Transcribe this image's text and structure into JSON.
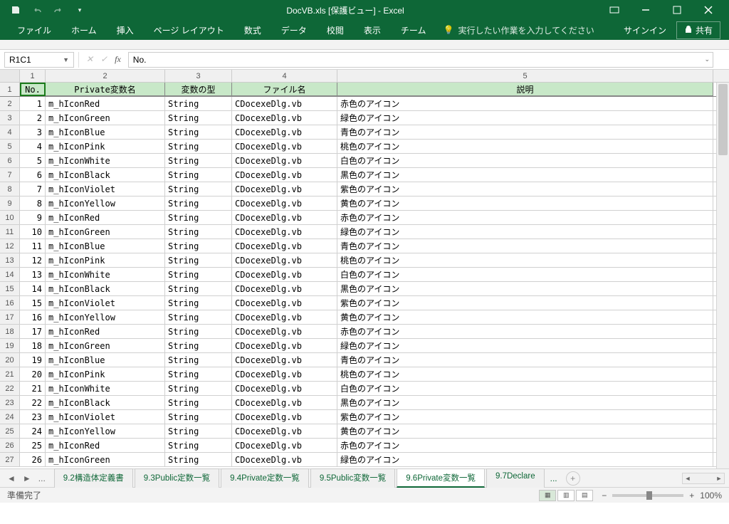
{
  "title": "DocVB.xls  [保護ビュー] - Excel",
  "qat": {
    "save": "save",
    "undo": "undo",
    "redo": "redo",
    "custom": "custom"
  },
  "ribbon": {
    "tabs": [
      "ファイル",
      "ホーム",
      "挿入",
      "ページ レイアウト",
      "数式",
      "データ",
      "校閲",
      "表示",
      "チーム"
    ],
    "tellme_placeholder": "実行したい作業を入力してください",
    "signin": "サインイン",
    "share": "共有"
  },
  "namebox": "R1C1",
  "formula": "No.",
  "columns": {
    "nums": [
      "1",
      "2",
      "3",
      "4",
      "5"
    ]
  },
  "headers": [
    "No.",
    "Private変数名",
    "変数の型",
    "ファイル名",
    "説明"
  ],
  "rows": [
    {
      "n": "1",
      "v": "m_hIconRed",
      "t": "String",
      "f": "CDocexeDlg.vb",
      "d": "赤色のアイコン"
    },
    {
      "n": "2",
      "v": "m_hIconGreen",
      "t": "String",
      "f": "CDocexeDlg.vb",
      "d": "緑色のアイコン"
    },
    {
      "n": "3",
      "v": "m_hIconBlue",
      "t": "String",
      "f": "CDocexeDlg.vb",
      "d": "青色のアイコン"
    },
    {
      "n": "4",
      "v": "m_hIconPink",
      "t": "String",
      "f": "CDocexeDlg.vb",
      "d": "桃色のアイコン"
    },
    {
      "n": "5",
      "v": "m_hIconWhite",
      "t": "String",
      "f": "CDocexeDlg.vb",
      "d": "白色のアイコン"
    },
    {
      "n": "6",
      "v": "m_hIconBlack",
      "t": "String",
      "f": "CDocexeDlg.vb",
      "d": "黒色のアイコン"
    },
    {
      "n": "7",
      "v": "m_hIconViolet",
      "t": "String",
      "f": "CDocexeDlg.vb",
      "d": "紫色のアイコン"
    },
    {
      "n": "8",
      "v": "m_hIconYellow",
      "t": "String",
      "f": "CDocexeDlg.vb",
      "d": "黄色のアイコン"
    },
    {
      "n": "9",
      "v": "m_hIconRed",
      "t": "String",
      "f": "CDocexeDlg.vb",
      "d": "赤色のアイコン"
    },
    {
      "n": "10",
      "v": "m_hIconGreen",
      "t": "String",
      "f": "CDocexeDlg.vb",
      "d": "緑色のアイコン"
    },
    {
      "n": "11",
      "v": "m_hIconBlue",
      "t": "String",
      "f": "CDocexeDlg.vb",
      "d": "青色のアイコン"
    },
    {
      "n": "12",
      "v": "m_hIconPink",
      "t": "String",
      "f": "CDocexeDlg.vb",
      "d": "桃色のアイコン"
    },
    {
      "n": "13",
      "v": "m_hIconWhite",
      "t": "String",
      "f": "CDocexeDlg.vb",
      "d": "白色のアイコン"
    },
    {
      "n": "14",
      "v": "m_hIconBlack",
      "t": "String",
      "f": "CDocexeDlg.vb",
      "d": "黒色のアイコン"
    },
    {
      "n": "15",
      "v": "m_hIconViolet",
      "t": "String",
      "f": "CDocexeDlg.vb",
      "d": "紫色のアイコン"
    },
    {
      "n": "16",
      "v": "m_hIconYellow",
      "t": "String",
      "f": "CDocexeDlg.vb",
      "d": "黄色のアイコン"
    },
    {
      "n": "17",
      "v": "m_hIconRed",
      "t": "String",
      "f": "CDocexeDlg.vb",
      "d": "赤色のアイコン"
    },
    {
      "n": "18",
      "v": "m_hIconGreen",
      "t": "String",
      "f": "CDocexeDlg.vb",
      "d": "緑色のアイコン"
    },
    {
      "n": "19",
      "v": "m_hIconBlue",
      "t": "String",
      "f": "CDocexeDlg.vb",
      "d": "青色のアイコン"
    },
    {
      "n": "20",
      "v": "m_hIconPink",
      "t": "String",
      "f": "CDocexeDlg.vb",
      "d": "桃色のアイコン"
    },
    {
      "n": "21",
      "v": "m_hIconWhite",
      "t": "String",
      "f": "CDocexeDlg.vb",
      "d": "白色のアイコン"
    },
    {
      "n": "22",
      "v": "m_hIconBlack",
      "t": "String",
      "f": "CDocexeDlg.vb",
      "d": "黒色のアイコン"
    },
    {
      "n": "23",
      "v": "m_hIconViolet",
      "t": "String",
      "f": "CDocexeDlg.vb",
      "d": "紫色のアイコン"
    },
    {
      "n": "24",
      "v": "m_hIconYellow",
      "t": "String",
      "f": "CDocexeDlg.vb",
      "d": "黄色のアイコン"
    },
    {
      "n": "25",
      "v": "m_hIconRed",
      "t": "String",
      "f": "CDocexeDlg.vb",
      "d": "赤色のアイコン"
    },
    {
      "n": "26",
      "v": "m_hIconGreen",
      "t": "String",
      "f": "CDocexeDlg.vb",
      "d": "緑色のアイコン"
    }
  ],
  "sheets": {
    "overflow_left": "...",
    "tabs": [
      "9.2構造体定義書",
      "9.3Public定数一覧",
      "9.4Private定数一覧",
      "9.5Public変数一覧",
      "9.6Private変数一覧",
      "9.7Declare"
    ],
    "active_index": 4,
    "overflow_right": "..."
  },
  "status": {
    "ready": "準備完了",
    "zoom": "100%"
  }
}
